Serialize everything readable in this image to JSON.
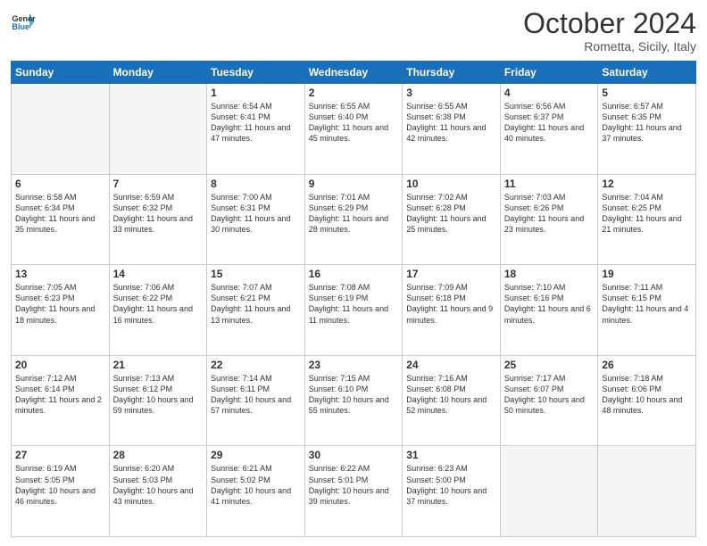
{
  "header": {
    "logo_general": "General",
    "logo_blue": "Blue",
    "month": "October 2024",
    "location": "Rometta, Sicily, Italy"
  },
  "weekdays": [
    "Sunday",
    "Monday",
    "Tuesday",
    "Wednesday",
    "Thursday",
    "Friday",
    "Saturday"
  ],
  "weeks": [
    [
      {
        "day": "",
        "sunrise": "",
        "sunset": "",
        "daylight": "",
        "empty": true
      },
      {
        "day": "",
        "sunrise": "",
        "sunset": "",
        "daylight": "",
        "empty": true
      },
      {
        "day": "1",
        "sunrise": "Sunrise: 6:54 AM",
        "sunset": "Sunset: 6:41 PM",
        "daylight": "Daylight: 11 hours and 47 minutes."
      },
      {
        "day": "2",
        "sunrise": "Sunrise: 6:55 AM",
        "sunset": "Sunset: 6:40 PM",
        "daylight": "Daylight: 11 hours and 45 minutes."
      },
      {
        "day": "3",
        "sunrise": "Sunrise: 6:55 AM",
        "sunset": "Sunset: 6:38 PM",
        "daylight": "Daylight: 11 hours and 42 minutes."
      },
      {
        "day": "4",
        "sunrise": "Sunrise: 6:56 AM",
        "sunset": "Sunset: 6:37 PM",
        "daylight": "Daylight: 11 hours and 40 minutes."
      },
      {
        "day": "5",
        "sunrise": "Sunrise: 6:57 AM",
        "sunset": "Sunset: 6:35 PM",
        "daylight": "Daylight: 11 hours and 37 minutes."
      }
    ],
    [
      {
        "day": "6",
        "sunrise": "Sunrise: 6:58 AM",
        "sunset": "Sunset: 6:34 PM",
        "daylight": "Daylight: 11 hours and 35 minutes."
      },
      {
        "day": "7",
        "sunrise": "Sunrise: 6:59 AM",
        "sunset": "Sunset: 6:32 PM",
        "daylight": "Daylight: 11 hours and 33 minutes."
      },
      {
        "day": "8",
        "sunrise": "Sunrise: 7:00 AM",
        "sunset": "Sunset: 6:31 PM",
        "daylight": "Daylight: 11 hours and 30 minutes."
      },
      {
        "day": "9",
        "sunrise": "Sunrise: 7:01 AM",
        "sunset": "Sunset: 6:29 PM",
        "daylight": "Daylight: 11 hours and 28 minutes."
      },
      {
        "day": "10",
        "sunrise": "Sunrise: 7:02 AM",
        "sunset": "Sunset: 6:28 PM",
        "daylight": "Daylight: 11 hours and 25 minutes."
      },
      {
        "day": "11",
        "sunrise": "Sunrise: 7:03 AM",
        "sunset": "Sunset: 6:26 PM",
        "daylight": "Daylight: 11 hours and 23 minutes."
      },
      {
        "day": "12",
        "sunrise": "Sunrise: 7:04 AM",
        "sunset": "Sunset: 6:25 PM",
        "daylight": "Daylight: 11 hours and 21 minutes."
      }
    ],
    [
      {
        "day": "13",
        "sunrise": "Sunrise: 7:05 AM",
        "sunset": "Sunset: 6:23 PM",
        "daylight": "Daylight: 11 hours and 18 minutes."
      },
      {
        "day": "14",
        "sunrise": "Sunrise: 7:06 AM",
        "sunset": "Sunset: 6:22 PM",
        "daylight": "Daylight: 11 hours and 16 minutes."
      },
      {
        "day": "15",
        "sunrise": "Sunrise: 7:07 AM",
        "sunset": "Sunset: 6:21 PM",
        "daylight": "Daylight: 11 hours and 13 minutes."
      },
      {
        "day": "16",
        "sunrise": "Sunrise: 7:08 AM",
        "sunset": "Sunset: 6:19 PM",
        "daylight": "Daylight: 11 hours and 11 minutes."
      },
      {
        "day": "17",
        "sunrise": "Sunrise: 7:09 AM",
        "sunset": "Sunset: 6:18 PM",
        "daylight": "Daylight: 11 hours and 9 minutes."
      },
      {
        "day": "18",
        "sunrise": "Sunrise: 7:10 AM",
        "sunset": "Sunset: 6:16 PM",
        "daylight": "Daylight: 11 hours and 6 minutes."
      },
      {
        "day": "19",
        "sunrise": "Sunrise: 7:11 AM",
        "sunset": "Sunset: 6:15 PM",
        "daylight": "Daylight: 11 hours and 4 minutes."
      }
    ],
    [
      {
        "day": "20",
        "sunrise": "Sunrise: 7:12 AM",
        "sunset": "Sunset: 6:14 PM",
        "daylight": "Daylight: 11 hours and 2 minutes."
      },
      {
        "day": "21",
        "sunrise": "Sunrise: 7:13 AM",
        "sunset": "Sunset: 6:12 PM",
        "daylight": "Daylight: 10 hours and 59 minutes."
      },
      {
        "day": "22",
        "sunrise": "Sunrise: 7:14 AM",
        "sunset": "Sunset: 6:11 PM",
        "daylight": "Daylight: 10 hours and 57 minutes."
      },
      {
        "day": "23",
        "sunrise": "Sunrise: 7:15 AM",
        "sunset": "Sunset: 6:10 PM",
        "daylight": "Daylight: 10 hours and 55 minutes."
      },
      {
        "day": "24",
        "sunrise": "Sunrise: 7:16 AM",
        "sunset": "Sunset: 6:08 PM",
        "daylight": "Daylight: 10 hours and 52 minutes."
      },
      {
        "day": "25",
        "sunrise": "Sunrise: 7:17 AM",
        "sunset": "Sunset: 6:07 PM",
        "daylight": "Daylight: 10 hours and 50 minutes."
      },
      {
        "day": "26",
        "sunrise": "Sunrise: 7:18 AM",
        "sunset": "Sunset: 6:06 PM",
        "daylight": "Daylight: 10 hours and 48 minutes."
      }
    ],
    [
      {
        "day": "27",
        "sunrise": "Sunrise: 6:19 AM",
        "sunset": "Sunset: 5:05 PM",
        "daylight": "Daylight: 10 hours and 46 minutes."
      },
      {
        "day": "28",
        "sunrise": "Sunrise: 6:20 AM",
        "sunset": "Sunset: 5:03 PM",
        "daylight": "Daylight: 10 hours and 43 minutes."
      },
      {
        "day": "29",
        "sunrise": "Sunrise: 6:21 AM",
        "sunset": "Sunset: 5:02 PM",
        "daylight": "Daylight: 10 hours and 41 minutes."
      },
      {
        "day": "30",
        "sunrise": "Sunrise: 6:22 AM",
        "sunset": "Sunset: 5:01 PM",
        "daylight": "Daylight: 10 hours and 39 minutes."
      },
      {
        "day": "31",
        "sunrise": "Sunrise: 6:23 AM",
        "sunset": "Sunset: 5:00 PM",
        "daylight": "Daylight: 10 hours and 37 minutes."
      },
      {
        "day": "",
        "sunrise": "",
        "sunset": "",
        "daylight": "",
        "empty": true
      },
      {
        "day": "",
        "sunrise": "",
        "sunset": "",
        "daylight": "",
        "empty": true
      }
    ]
  ]
}
